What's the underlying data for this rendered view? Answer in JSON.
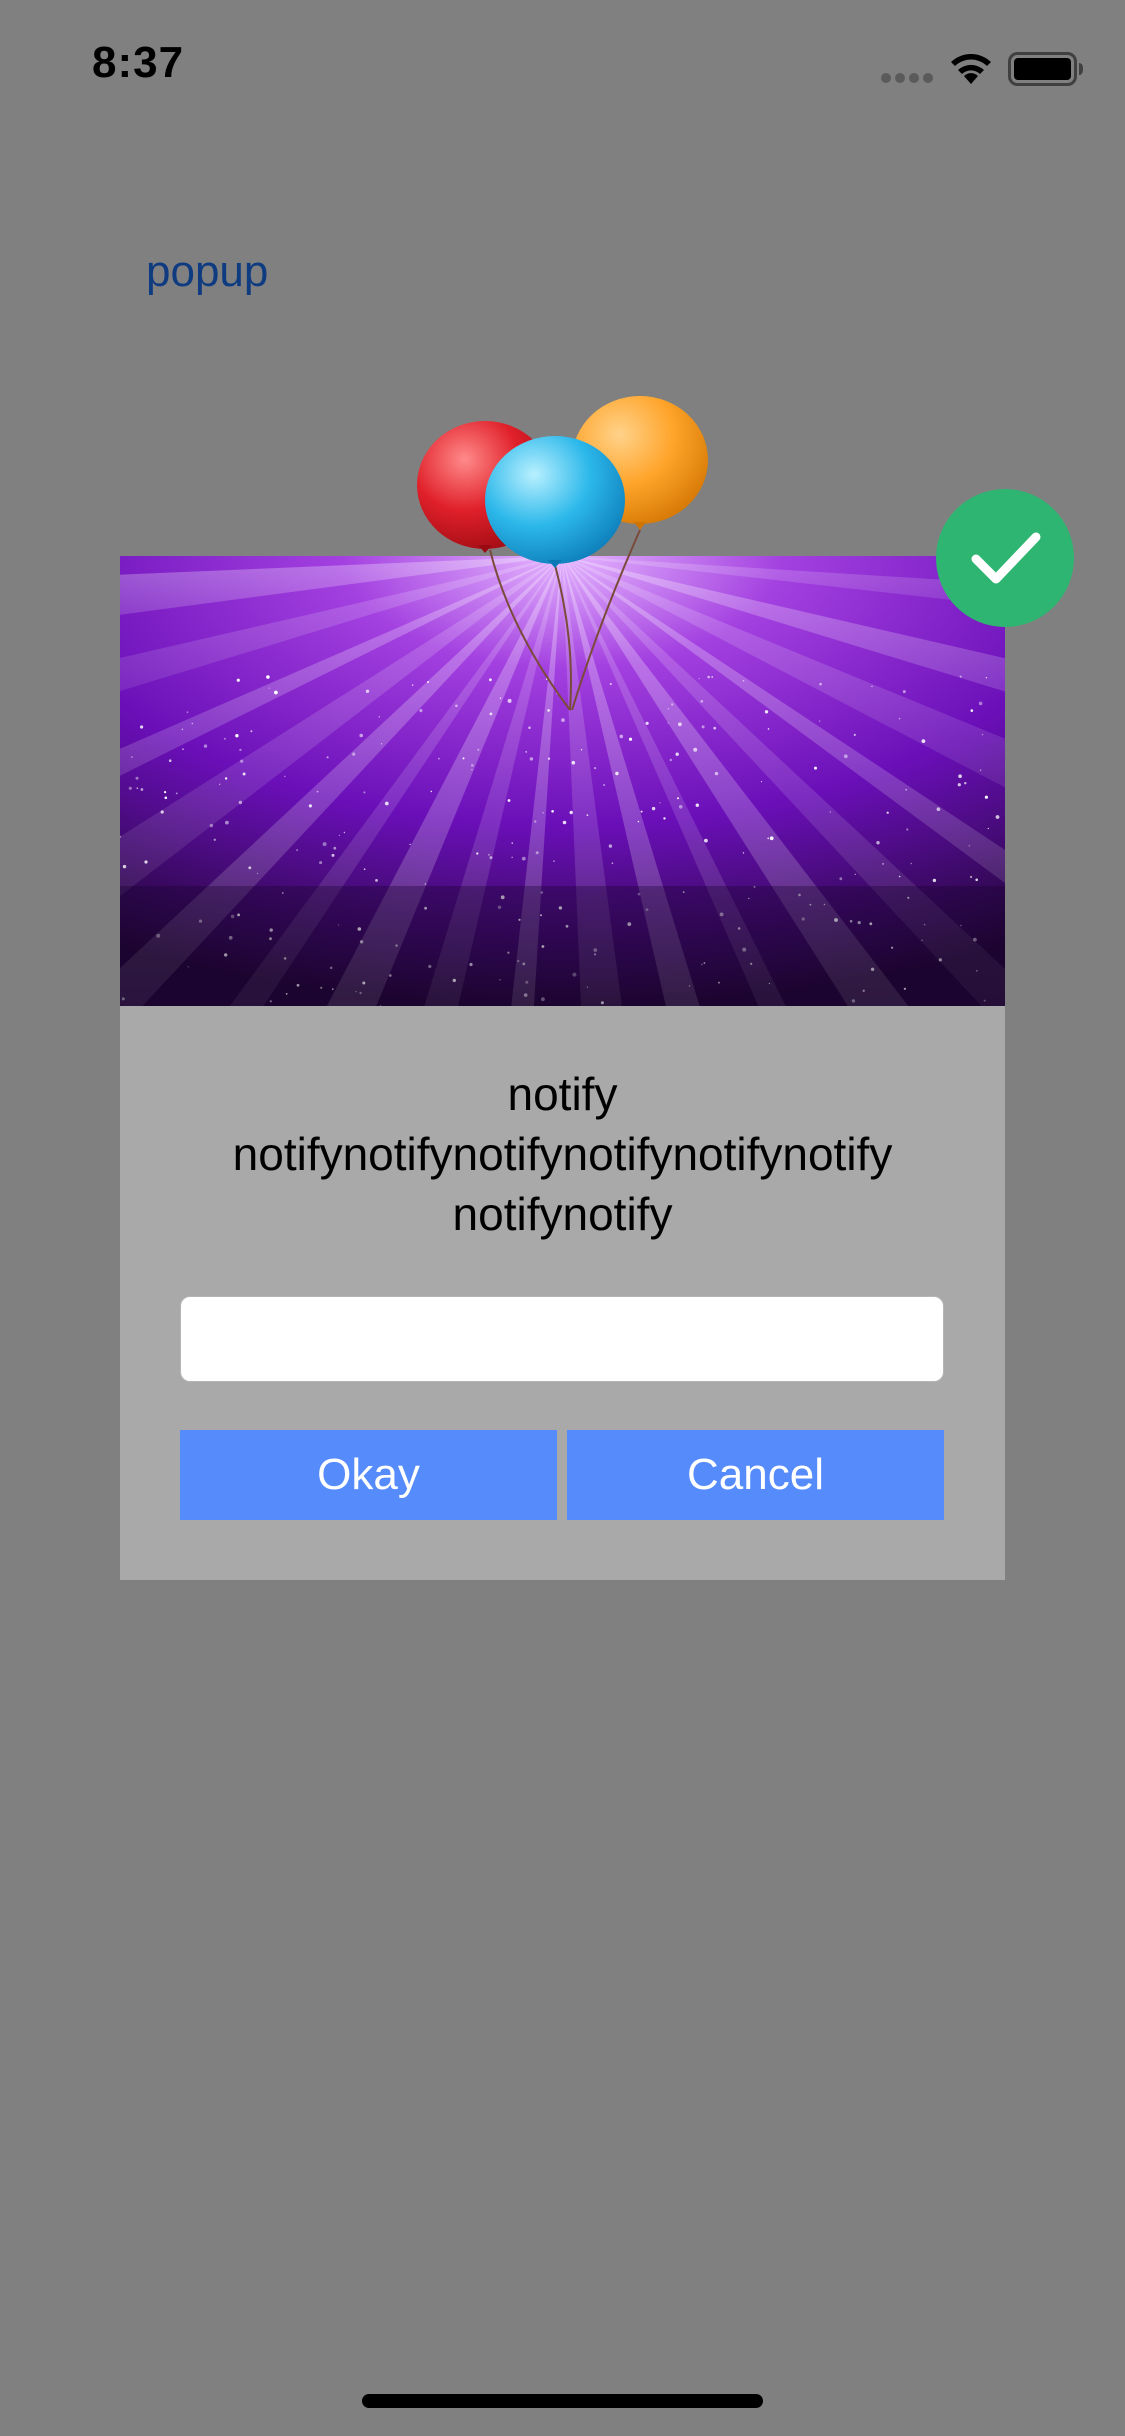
{
  "status_bar": {
    "time": "8:37",
    "signal_icon": "signal-dots-icon",
    "wifi_icon": "wifi-icon",
    "battery_icon": "battery-icon"
  },
  "link": {
    "label": "popup",
    "color": "#0f3b80"
  },
  "dialog": {
    "message_lines": [
      "notify",
      "notifynotifynotifynotifynotifynotify",
      "notifynotify"
    ],
    "input": {
      "value": "",
      "placeholder": ""
    },
    "okay_label": "Okay",
    "cancel_label": "Cancel",
    "button_color": "#568bfc",
    "badge_icon": "checkmark-icon",
    "badge_color": "#2fb572",
    "header_image": "purple-starburst-image",
    "decoration": "balloons-icon"
  }
}
